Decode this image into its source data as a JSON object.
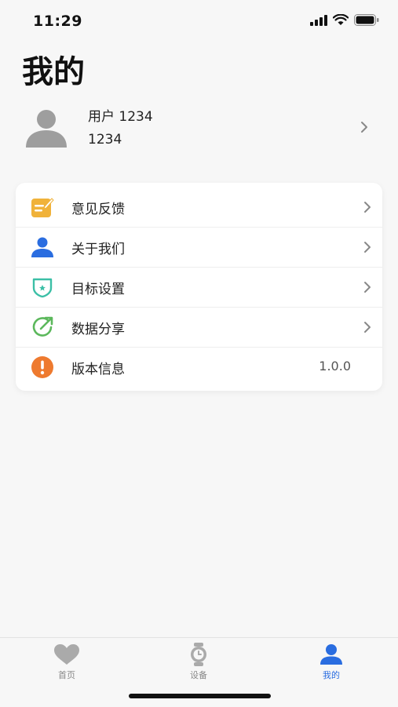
{
  "status_bar": {
    "time": "11:29"
  },
  "page": {
    "title": "我的"
  },
  "profile": {
    "username": "用户 1234",
    "user_id": "1234"
  },
  "menu": [
    {
      "label": "意见反馈",
      "icon": "feedback-icon",
      "color": "#f0b23a",
      "value": "",
      "has_chevron": true
    },
    {
      "label": "关于我们",
      "icon": "person-icon",
      "color": "#2a6de0",
      "value": "",
      "has_chevron": true
    },
    {
      "label": "目标设置",
      "icon": "target-shield-icon",
      "color": "#3bbfa6",
      "value": "",
      "has_chevron": true
    },
    {
      "label": "数据分享",
      "icon": "share-icon",
      "color": "#5cb85c",
      "value": "",
      "has_chevron": true
    },
    {
      "label": "版本信息",
      "icon": "info-icon",
      "color": "#ee7a2f",
      "value": "1.0.0",
      "has_chevron": false
    }
  ],
  "tabs": [
    {
      "label": "首页",
      "icon": "heart-icon",
      "active": false
    },
    {
      "label": "设备",
      "icon": "watch-icon",
      "active": false
    },
    {
      "label": "我的",
      "icon": "person-icon",
      "active": true
    }
  ],
  "colors": {
    "accent": "#2a6de0",
    "inactive": "#aaaaaa",
    "background": "#f7f7f7"
  }
}
